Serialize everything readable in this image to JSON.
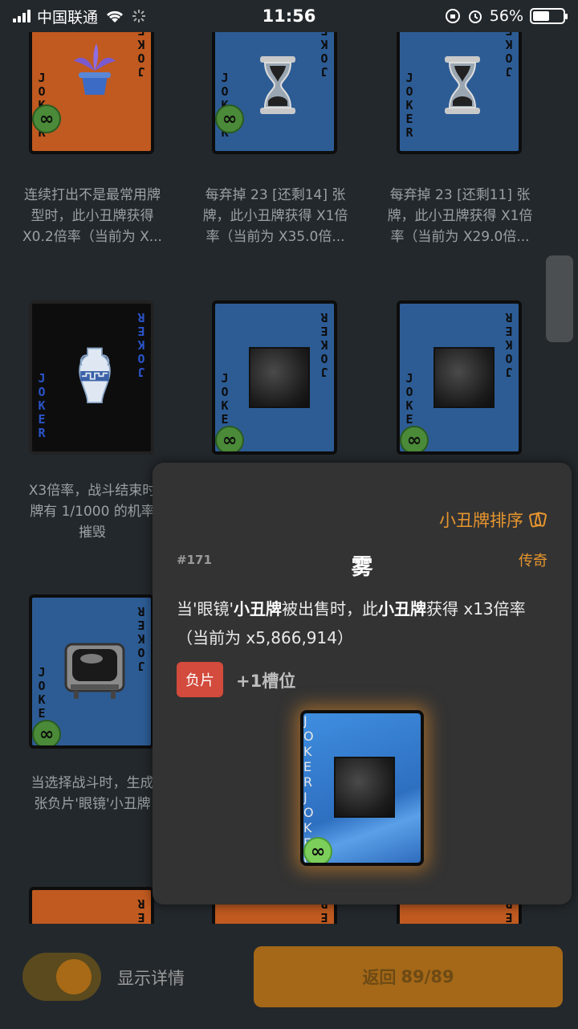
{
  "status": {
    "carrier": "中国联通",
    "time": "11:56",
    "battery": "56%",
    "battery_level": 0.56
  },
  "joker_letters": [
    "J",
    "O",
    "K",
    "E",
    "R"
  ],
  "badge_symbol": "∞",
  "cards": [
    {
      "desc": [
        "连续打出不是最常用牌",
        "型时，此小丑牌获得",
        "X0.2倍率（当前为 X..."
      ],
      "art": "potted-plant-icon"
    },
    {
      "desc": [
        "每弃掉 23 [还剩14] 张",
        "牌，此小丑牌获得 X1倍",
        "率（当前为 X35.0倍..."
      ],
      "art": "hourglass-icon"
    },
    {
      "desc": [
        "每弃掉 23 [还剩11] 张",
        "牌，此小丑牌获得 X1倍",
        "率（当前为 X29.0倍..."
      ],
      "art": "hourglass-icon"
    },
    {
      "desc": [
        "X3倍率，战斗结束时",
        "牌有 1/1000 的机率",
        "摧毁"
      ],
      "art": "greek-vase-icon"
    },
    {
      "desc": [],
      "art": "fog-icon"
    },
    {
      "desc": [],
      "art": "fog-icon"
    },
    {
      "desc": [
        "当选择战斗时，生成",
        "张负片'眼镜'小丑牌"
      ],
      "art": "tv-icon"
    }
  ],
  "popup": {
    "sort_label": "小丑牌排序",
    "number": "#171",
    "name": "雾",
    "rarity": "传奇",
    "text_part1": "当'眼镜'",
    "text_bold1": "小丑牌",
    "text_part2": "被出售时，此",
    "text_bold2": "小丑牌",
    "text_part3": "获得 x13倍率（当前为 x5,866,914）",
    "tag": "负片",
    "slot": "+1槽位"
  },
  "footer": {
    "toggle_label": "显示详情",
    "toggle_on": true,
    "back_label": "返回",
    "back_count": "89/89"
  }
}
